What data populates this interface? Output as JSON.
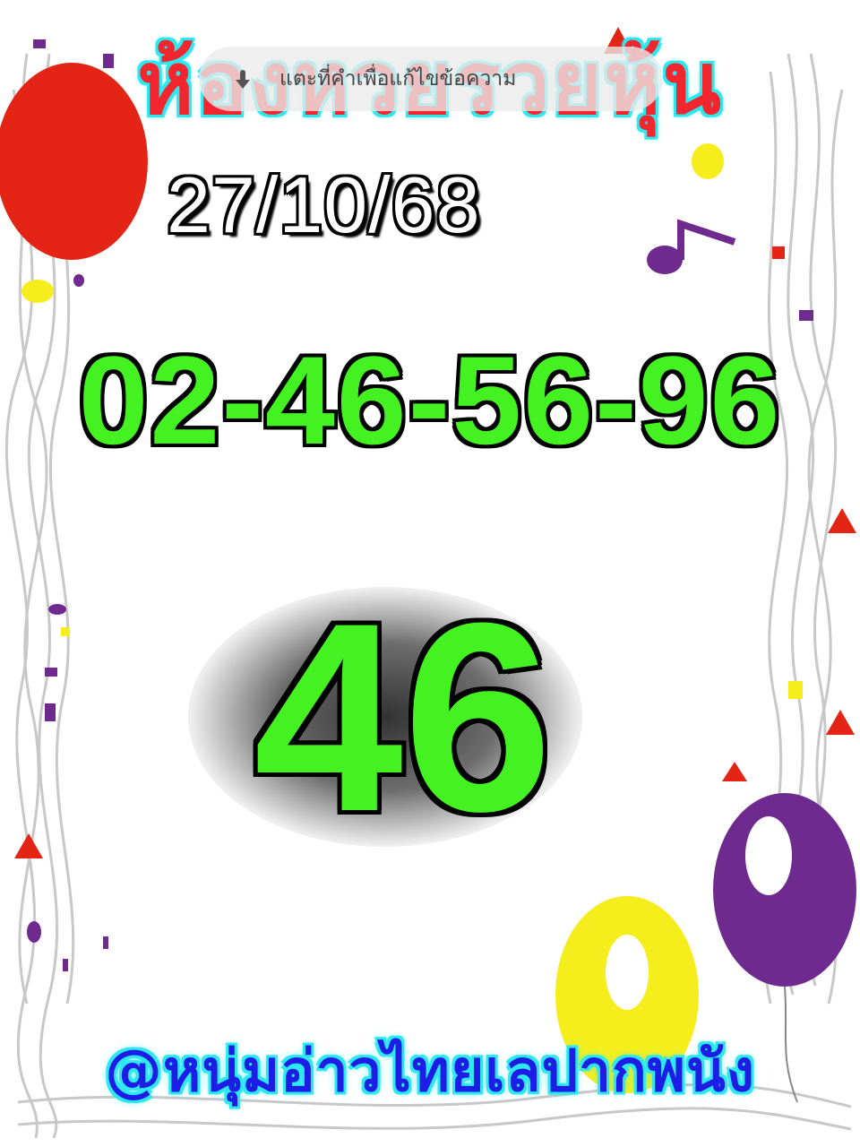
{
  "title": "ห้องหวยรวยหุ้น",
  "edit_hint": {
    "text": "แตะที่คำเพื่อแก้ไขข้อความ",
    "icon": "tap-hand-icon"
  },
  "date": "27/10/68",
  "numbers_line": "02-46-56-96",
  "main_number": "46",
  "footer": "@หนุ่มอ่าวไทยเลปากพนัง",
  "colors": {
    "title": "#f2262e",
    "title_outline": "#2fe8f0",
    "numbers": "#44f222",
    "footer": "#1d1de6",
    "balloon_red": "#e42414",
    "balloon_purple": "#6e2a8e",
    "balloon_yellow": "#f5ee1c"
  }
}
